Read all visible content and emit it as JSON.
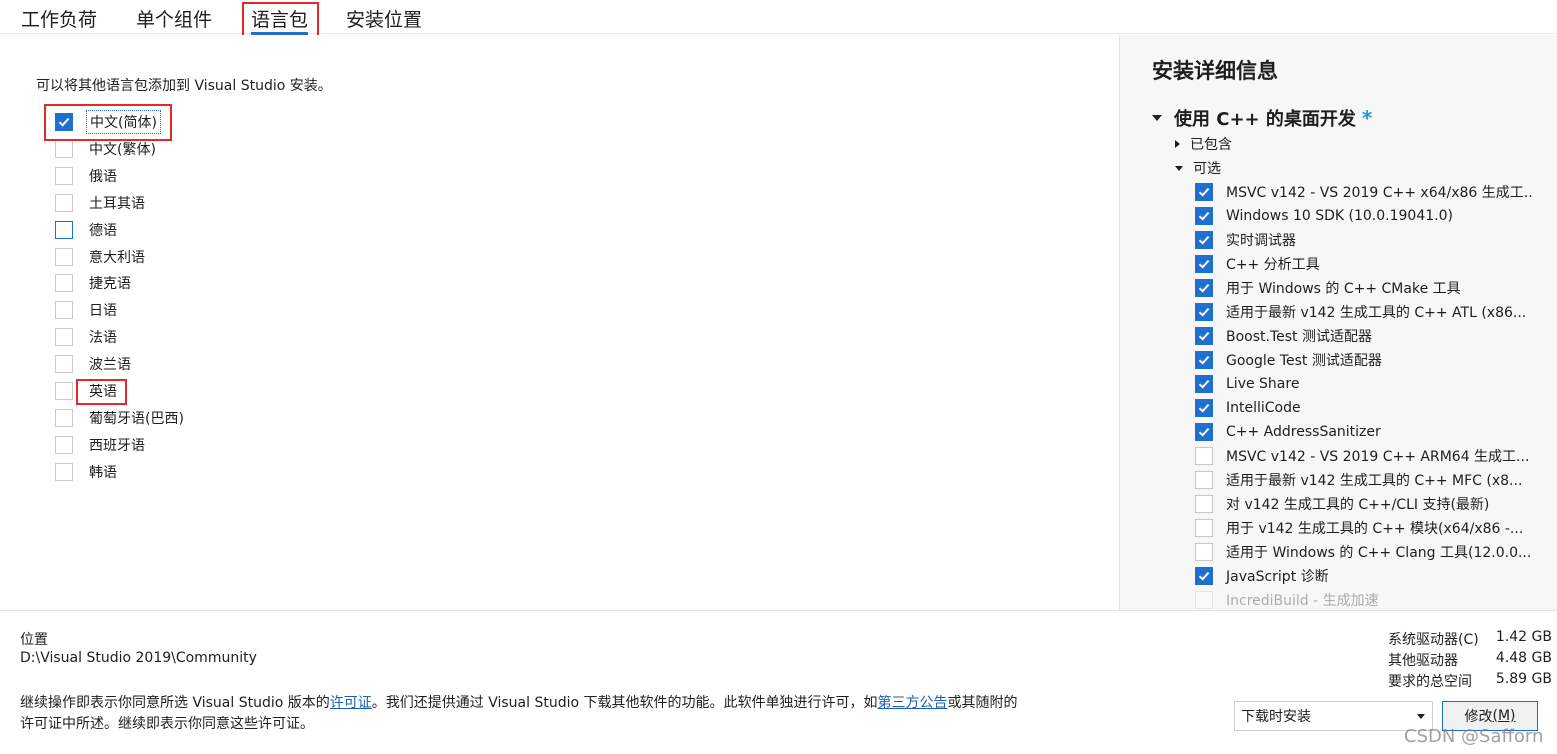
{
  "tabs": [
    {
      "label": "工作负荷"
    },
    {
      "label": "单个组件"
    },
    {
      "label": "语言包"
    },
    {
      "label": "安装位置"
    }
  ],
  "languages": {
    "intro": "可以将其他语言包添加到 Visual Studio 安装。",
    "items": [
      {
        "label": "中文(简体)",
        "checked": true
      },
      {
        "label": "中文(繁体)",
        "checked": false
      },
      {
        "label": "俄语",
        "checked": false
      },
      {
        "label": "土耳其语",
        "checked": false
      },
      {
        "label": "德语",
        "checked": false
      },
      {
        "label": "意大利语",
        "checked": false
      },
      {
        "label": "捷克语",
        "checked": false
      },
      {
        "label": "日语",
        "checked": false
      },
      {
        "label": "法语",
        "checked": false
      },
      {
        "label": "波兰语",
        "checked": false
      },
      {
        "label": "英语",
        "checked": false
      },
      {
        "label": "葡萄牙语(巴西)",
        "checked": false
      },
      {
        "label": "西班牙语",
        "checked": false
      },
      {
        "label": "韩语",
        "checked": false
      }
    ]
  },
  "details": {
    "title": "安装详细信息",
    "workload": "使用 C++ 的桌面开发",
    "workload_star": "*",
    "included_label": "已包含",
    "optional_label": "可选",
    "optional_items": [
      {
        "label": "MSVC v142 - VS 2019 C++ x64/x86 生成工...",
        "checked": true
      },
      {
        "label": "Windows 10 SDK (10.0.19041.0)",
        "checked": true
      },
      {
        "label": "实时调试器",
        "checked": true
      },
      {
        "label": "C++ 分析工具",
        "checked": true
      },
      {
        "label": "用于 Windows 的 C++ CMake 工具",
        "checked": true
      },
      {
        "label": "适用于最新 v142 生成工具的 C++ ATL (x86...",
        "checked": true
      },
      {
        "label": "Boost.Test 测试适配器",
        "checked": true
      },
      {
        "label": "Google Test 测试适配器",
        "checked": true
      },
      {
        "label": "Live Share",
        "checked": true
      },
      {
        "label": "IntelliCode",
        "checked": true
      },
      {
        "label": "C++ AddressSanitizer",
        "checked": true
      },
      {
        "label": "MSVC v142 - VS 2019 C++ ARM64 生成工...",
        "checked": false
      },
      {
        "label": "适用于最新 v142 生成工具的 C++ MFC (x8...",
        "checked": false
      },
      {
        "label": "对 v142 生成工具的 C++/CLI 支持(最新)",
        "checked": false
      },
      {
        "label": "用于 v142 生成工具的 C++ 模块(x64/x86 -...",
        "checked": false
      },
      {
        "label": "适用于 Windows 的 C++ Clang 工具(12.0.0...",
        "checked": false
      },
      {
        "label": "JavaScript 诊断",
        "checked": true
      },
      {
        "label": "IncrediBuild - 生成加速",
        "checked": false
      }
    ]
  },
  "bottom": {
    "location_label": "位置",
    "location_path": "D:\\Visual Studio 2019\\Community",
    "legal_part1": "继续操作即表示你同意所选 Visual Studio 版本的",
    "legal_link1": "许可证",
    "legal_part2": "。我们还提供通过 Visual Studio 下载其他软件的功能。此软件单独进行许可，如",
    "legal_link2": "第三方公告",
    "legal_part3": "或其随附的许可证中所述。继续即表示你同意这些许可证。",
    "space": [
      {
        "label": "系统驱动器(C)",
        "value": "1.42 GB"
      },
      {
        "label": "其他驱动器",
        "value": "4.48 GB"
      },
      {
        "label": "要求的总空间",
        "value": "5.89 GB"
      }
    ],
    "install_mode": "下载时安装",
    "modify_label": "修改",
    "modify_accel": "(M)"
  },
  "watermark": "CSDN @Safforn",
  "colors": {
    "accent": "#1e6fd0",
    "highlight_box": "#e0292b",
    "link": "#1a5fb4"
  }
}
